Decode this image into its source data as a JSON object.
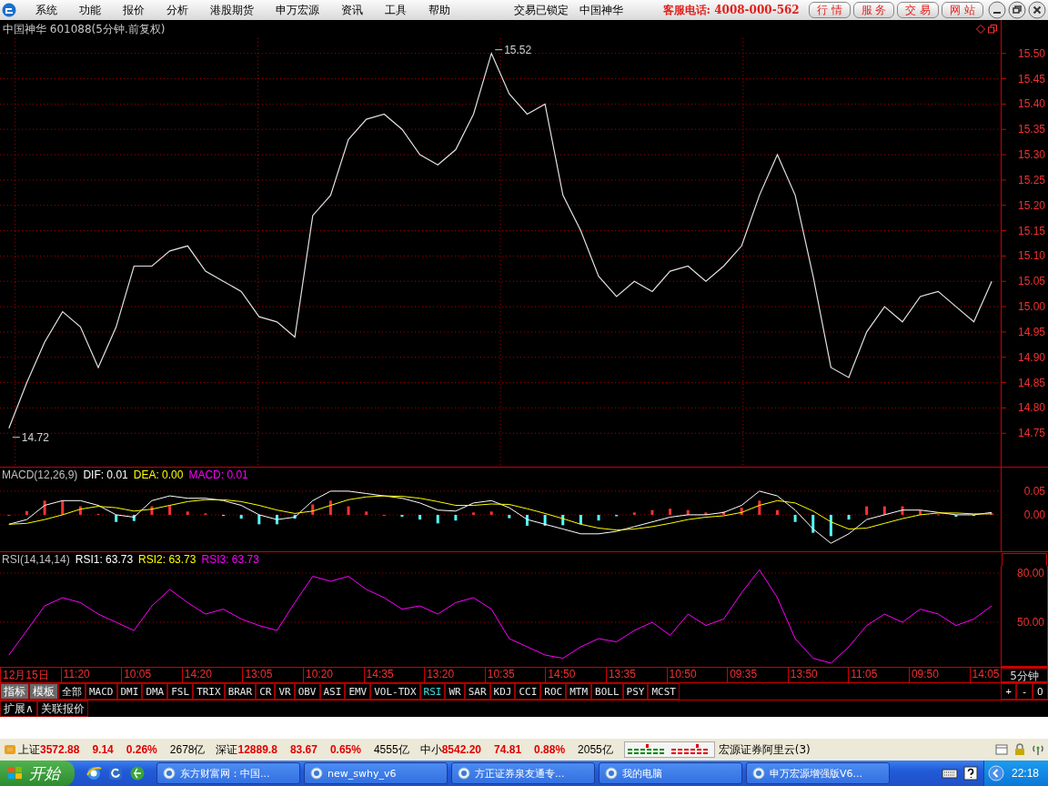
{
  "menubar": {
    "items": [
      "系统",
      "功能",
      "报价",
      "分析",
      "港股期货",
      "申万宏源",
      "资讯",
      "工具",
      "帮助"
    ],
    "lock_status": "交易已锁定",
    "stock": "中国神华",
    "hotline": "客服电话: 4008-000-562",
    "buttons": [
      "行 情",
      "服 务",
      "交 易",
      "网 站"
    ]
  },
  "chart_title": "中国神华 601088(5分钟.前复权)",
  "price_chart": {
    "chart_data": {
      "type": "line",
      "grid": true,
      "ylim": [
        14.684,
        15.53
      ],
      "yticks": [
        {
          "value": 14.75,
          "label": "14.75"
        },
        {
          "value": 14.8,
          "label": "14.80"
        },
        {
          "value": 14.85,
          "label": "14.85"
        },
        {
          "value": 14.9,
          "label": "14.90"
        },
        {
          "value": 14.95,
          "label": "14.95"
        },
        {
          "value": 15.0,
          "label": "15.00"
        },
        {
          "value": 15.05,
          "label": "15.05"
        },
        {
          "value": 15.1,
          "label": "15.10"
        },
        {
          "value": 15.15,
          "label": "15.15"
        },
        {
          "value": 15.2,
          "label": "15.20"
        },
        {
          "value": 15.25,
          "label": "15.25"
        },
        {
          "value": 15.3,
          "label": "15.30"
        },
        {
          "value": 15.35,
          "label": "15.35"
        },
        {
          "value": 15.4,
          "label": "15.40"
        },
        {
          "value": 15.45,
          "label": "15.45"
        },
        {
          "value": 15.5,
          "label": "15.50"
        }
      ],
      "series": [
        {
          "color": "#e0e0e0",
          "values": [
            14.76,
            14.85,
            14.93,
            14.99,
            14.96,
            14.88,
            14.96,
            15.08,
            15.08,
            15.11,
            15.12,
            15.07,
            15.05,
            15.03,
            14.98,
            14.97,
            14.94,
            15.18,
            15.22,
            15.33,
            15.37,
            15.38,
            15.35,
            15.3,
            15.28,
            15.31,
            15.38,
            15.5,
            15.42,
            15.38,
            15.4,
            15.22,
            15.15,
            15.06,
            15.02,
            15.05,
            15.03,
            15.07,
            15.08,
            15.05,
            15.08,
            15.12,
            15.22,
            15.3,
            15.22,
            15.06,
            14.88,
            14.86,
            14.95,
            15.0,
            14.97,
            15.02,
            15.03,
            15.0,
            14.97,
            15.05
          ]
        }
      ],
      "annotations": [
        {
          "text": "15.52"
        },
        {
          "text": "14.72"
        }
      ]
    }
  },
  "macd": {
    "title": "MACD(12,26,9)",
    "readouts": [
      {
        "label": "DIF: 0.01",
        "color": "#ffffff"
      },
      {
        "label": "DEA: 0.00",
        "color": "#ffff00"
      },
      {
        "label": "MACD: 0.01",
        "color": "#ff00ff"
      }
    ],
    "chart_data": {
      "type": "line",
      "grid": true,
      "ylim": [
        -0.077,
        0.071
      ],
      "yticks": [
        {
          "value": 0.0,
          "label": "0.00"
        },
        {
          "value": 0.05,
          "label": "0.05"
        }
      ],
      "series": [
        {
          "color": "#ffffff",
          "values": [
            -0.02,
            -0.01,
            0.02,
            0.03,
            0.03,
            0.02,
            0.0,
            -0.005,
            0.03,
            0.04,
            0.035,
            0.035,
            0.03,
            0.02,
            0.0,
            -0.01,
            -0.005,
            0.03,
            0.05,
            0.05,
            0.045,
            0.04,
            0.035,
            0.025,
            0.01,
            0.008,
            0.025,
            0.03,
            0.015,
            -0.01,
            -0.02,
            -0.03,
            -0.04,
            -0.04,
            -0.035,
            -0.025,
            -0.015,
            -0.005,
            0.0,
            0.0,
            0.005,
            0.02,
            0.05,
            0.04,
            0.01,
            -0.03,
            -0.06,
            -0.04,
            -0.01,
            0.0,
            0.01,
            0.01,
            0.005,
            0.0,
            0.0,
            0.005
          ]
        },
        {
          "color": "#ffff00",
          "values": [
            -0.02,
            -0.018,
            -0.01,
            0.0,
            0.012,
            0.018,
            0.015,
            0.008,
            0.012,
            0.02,
            0.028,
            0.032,
            0.032,
            0.028,
            0.02,
            0.01,
            0.003,
            0.008,
            0.02,
            0.032,
            0.038,
            0.04,
            0.039,
            0.035,
            0.028,
            0.02,
            0.02,
            0.023,
            0.022,
            0.013,
            0.003,
            -0.008,
            -0.02,
            -0.028,
            -0.032,
            -0.03,
            -0.025,
            -0.018,
            -0.01,
            -0.005,
            -0.002,
            0.005,
            0.02,
            0.03,
            0.025,
            0.008,
            -0.015,
            -0.03,
            -0.028,
            -0.018,
            -0.008,
            0.0,
            0.004,
            0.004,
            0.002,
            0.002
          ]
        }
      ]
    }
  },
  "rsi": {
    "title": "RSI(14,14,14)",
    "readouts": [
      {
        "label": "RSI1: 63.73",
        "color": "#ffffff"
      },
      {
        "label": "RSI2: 63.73",
        "color": "#ffff00"
      },
      {
        "label": "RSI3: 63.73",
        "color": "#ff00ff"
      }
    ],
    "chart_data": {
      "type": "line",
      "grid": true,
      "ylim": [
        22.8,
        84.4
      ],
      "yticks": [
        {
          "value": 50,
          "label": "50.00"
        },
        {
          "value": 80,
          "label": "80.00"
        }
      ],
      "series": [
        {
          "color": "#ff00ff",
          "values": [
            30,
            45,
            60,
            65,
            62,
            55,
            50,
            45,
            60,
            70,
            62,
            55,
            58,
            52,
            48,
            45,
            62,
            78,
            75,
            78,
            70,
            65,
            58,
            60,
            55,
            62,
            65,
            58,
            40,
            35,
            30,
            28,
            35,
            40,
            38,
            45,
            50,
            42,
            55,
            48,
            52,
            68,
            82,
            65,
            40,
            28,
            25,
            35,
            48,
            55,
            50,
            58,
            55,
            48,
            52,
            60
          ]
        }
      ]
    }
  },
  "x_axis": {
    "labels": [
      "12月15日",
      "11:20",
      "10:05",
      "14:20",
      "13:05",
      "10:20",
      "14:35",
      "13:20",
      "10:35",
      "14:50",
      "13:35",
      "10:50",
      "09:35",
      "13:50",
      "11:05",
      "09:50",
      "14:05"
    ],
    "period": "5分钟"
  },
  "indicator_tabs": [
    {
      "label": "指标",
      "kind": "group",
      "selected": false
    },
    {
      "label": "模板",
      "kind": "group",
      "selected": false
    },
    {
      "label": "全部",
      "kind": "indicator",
      "selected": false
    },
    {
      "label": "MACD",
      "kind": "indicator",
      "selected": false
    },
    {
      "label": "DMI",
      "kind": "indicator",
      "selected": false
    },
    {
      "label": "DMA",
      "kind": "indicator",
      "selected": false
    },
    {
      "label": "FSL",
      "kind": "indicator",
      "selected": false
    },
    {
      "label": "TRIX",
      "kind": "indicator",
      "selected": false
    },
    {
      "label": "BRAR",
      "kind": "indicator",
      "selected": false
    },
    {
      "label": "CR",
      "kind": "indicator",
      "selected": false
    },
    {
      "label": "VR",
      "kind": "indicator",
      "selected": false
    },
    {
      "label": "OBV",
      "kind": "indicator",
      "selected": false
    },
    {
      "label": "ASI",
      "kind": "indicator",
      "selected": false
    },
    {
      "label": "EMV",
      "kind": "indicator",
      "selected": false
    },
    {
      "label": "VOL-TDX",
      "kind": "indicator",
      "selected": false
    },
    {
      "label": "RSI",
      "kind": "indicator",
      "selected": true
    },
    {
      "label": "WR",
      "kind": "indicator",
      "selected": false
    },
    {
      "label": "SAR",
      "kind": "indicator",
      "selected": false
    },
    {
      "label": "KDJ",
      "kind": "indicator",
      "selected": false
    },
    {
      "label": "CCI",
      "kind": "indicator",
      "selected": false
    },
    {
      "label": "ROC",
      "kind": "indicator",
      "selected": false
    },
    {
      "label": "MTM",
      "kind": "indicator",
      "selected": false
    },
    {
      "label": "BOLL",
      "kind": "indicator",
      "selected": false
    },
    {
      "label": "PSY",
      "kind": "indicator",
      "selected": false
    },
    {
      "label": "MCST",
      "kind": "indicator",
      "selected": false
    }
  ],
  "zoom_buttons": [
    "+",
    "-",
    "0"
  ],
  "extra_tabs": [
    "扩展∧",
    "关联报价"
  ],
  "status_bar": {
    "indices": [
      {
        "name": "上证",
        "value": "3572.88",
        "change": "9.14",
        "percent": "0.26%",
        "amount": "2678亿",
        "up": true
      },
      {
        "name": "深证",
        "value": "12889.8",
        "change": "83.67",
        "percent": "0.65%",
        "amount": "4555亿",
        "up": true
      },
      {
        "name": "中小",
        "value": "8542.20",
        "change": "74.81",
        "percent": "0.88%",
        "amount": "2055亿",
        "up": true
      }
    ],
    "server": "宏源证券阿里云(3)"
  },
  "taskbar": {
    "start": "开始",
    "tasks": [
      "东方财富网：中国...",
      "new_swhy_v6",
      "方正证券泉友通专...",
      "我的电脑",
      "申万宏源增强版V6..."
    ],
    "clock": "22:18"
  }
}
